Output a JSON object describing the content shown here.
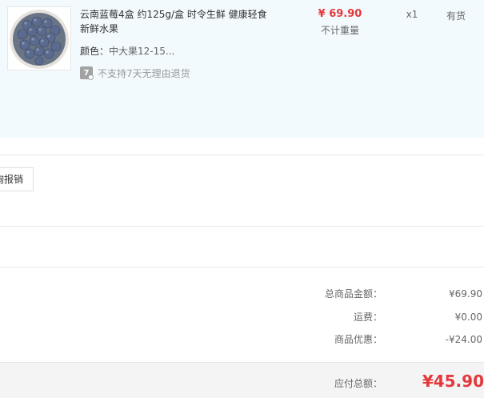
{
  "item": {
    "title": "云南蓝莓4盒 约125g/盒 时令生鲜 健康轻食新鲜水果",
    "attr_label": "颜色：",
    "attr_value": "中大果12-15...",
    "return_badge": "7",
    "return_text": "不支持7天无理由退货",
    "price": "¥ 69.90",
    "weight_note": "不计重量",
    "qty": "x1",
    "stock": "有货"
  },
  "invoice": {
    "button_label": "询报销"
  },
  "summary": {
    "rows": [
      {
        "label": "总商品金额：",
        "value": "¥69.90"
      },
      {
        "label": "运费：",
        "value": "¥0.00"
      },
      {
        "label": "商品优惠：",
        "value": "-¥24.00"
      }
    ],
    "total_label": "应付总额：",
    "total_value": "¥45.90"
  },
  "colors": {
    "price_red": "#e4393c",
    "row_bg": "#f3fafe",
    "berry": "#5b6b8f"
  }
}
